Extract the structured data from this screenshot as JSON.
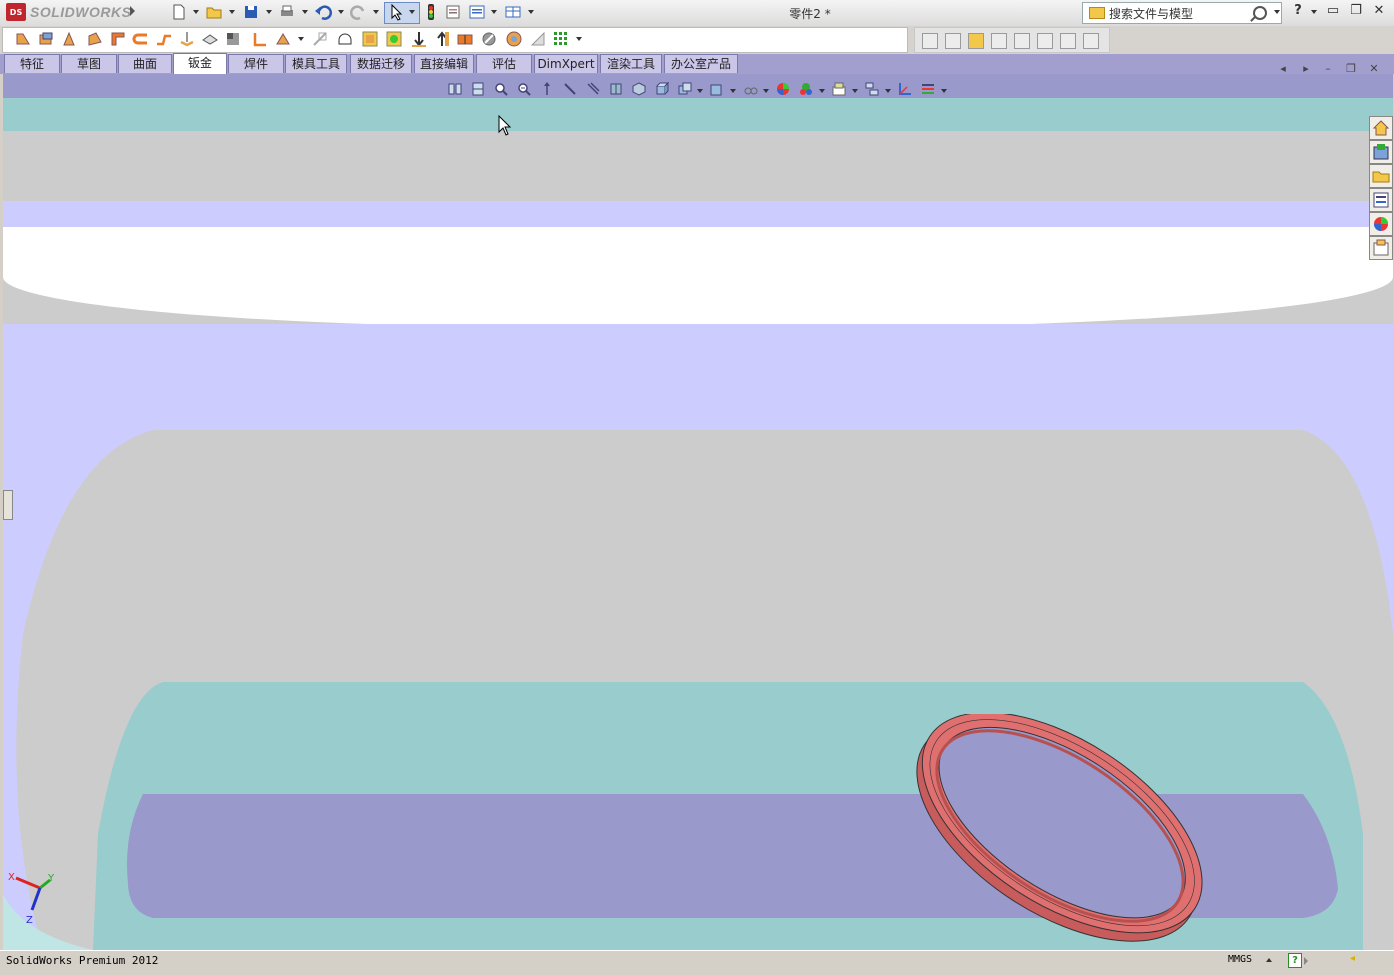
{
  "app": {
    "logo_text": "SOLIDWORKS",
    "logo_badge": "DS",
    "document_title": "零件2 *"
  },
  "search": {
    "placeholder": "搜索文件与模型"
  },
  "window_controls": {
    "help": "?",
    "minimize": "▭",
    "maximize": "❐",
    "close": "✕"
  },
  "tabs": [
    {
      "label": "特征",
      "active": false
    },
    {
      "label": "草图",
      "active": false
    },
    {
      "label": "曲面",
      "active": false
    },
    {
      "label": "钣金",
      "active": true
    },
    {
      "label": "焊件",
      "active": false
    },
    {
      "label": "模具工具",
      "active": false
    },
    {
      "label": "数据迁移",
      "active": false
    },
    {
      "label": "直接编辑",
      "active": false
    },
    {
      "label": "评估",
      "active": false
    },
    {
      "label": "DimXpert",
      "active": false
    },
    {
      "label": "渲染工具",
      "active": false
    },
    {
      "label": "办公室产品",
      "active": false
    }
  ],
  "status": {
    "version_text": "SolidWorks Premium 2012",
    "units": "MMGS",
    "help_badge": "?"
  },
  "triad": {
    "x_label": "X",
    "y_label": "Y",
    "z_label": "Z"
  },
  "colors": {
    "tab_bar": "#a29fcf",
    "viewport_teal": "#99cccc",
    "viewport_lavender": "#ccccff",
    "viewport_gray": "#cccccc",
    "viewport_purple": "#9999cc",
    "part_color": "#e07070",
    "logo_red": "#c0262d"
  },
  "icons": {
    "title_toolbar": [
      "new-document-icon",
      "open-folder-icon",
      "save-icon",
      "print-icon",
      "undo-icon",
      "redo-icon",
      "select-pointer-icon",
      "rebuild-traffic-light-icon",
      "file-properties-icon",
      "options-icon",
      "layout-icon"
    ],
    "sheet_metal_toolbar": [
      "base-flange-icon",
      "convert-to-sheet-metal-icon",
      "lofted-bend-icon",
      "edge-flange-icon",
      "miter-flange-icon",
      "hem-icon",
      "jog-icon",
      "sketched-bend-icon",
      "cross-break-icon",
      "corner-icon",
      "closed-corner-icon",
      "welded-corner-icon",
      "break-corner-icon",
      "vent-icon",
      "unfold-icon",
      "fold-icon",
      "flatten-icon",
      "no-bends-icon",
      "rip-icon",
      "insert-bends-icon",
      "forming-tool-icon",
      "sheet-metal-gusset-icon",
      "tab-and-slot-icon"
    ],
    "heads_up_toolbar": [
      "previous-view-icon",
      "zoom-to-fit-icon",
      "zoom-to-area-icon",
      "zoom-in-out-icon",
      "rotate-icon",
      "pan-icon",
      "section-view-icon",
      "view-orientation-icon",
      "display-style-icon",
      "hide-show-items-icon",
      "edit-appearance-icon",
      "apply-scene-icon",
      "view-settings-icon",
      "realview-icon",
      "shadows-icon"
    ],
    "task_pane": [
      "home-icon",
      "design-library-icon",
      "file-explorer-icon",
      "view-palette-icon",
      "appearances-icon",
      "custom-properties-icon"
    ]
  }
}
